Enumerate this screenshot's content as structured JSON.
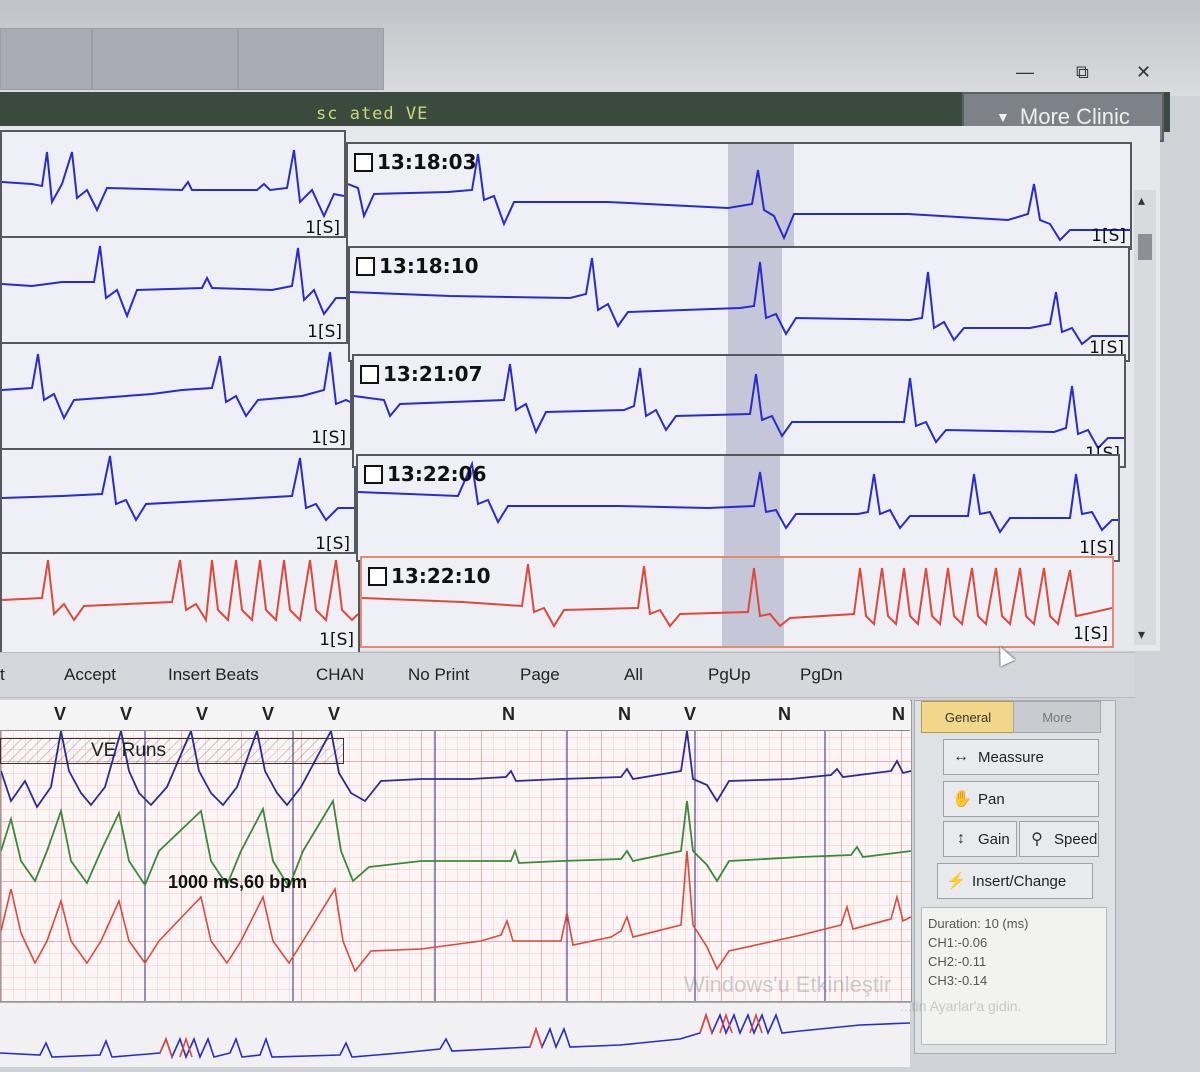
{
  "window": {
    "subtitle": "sc ated VE",
    "more_clinic_label": "More Clinic",
    "tabs": [
      "",
      "",
      ""
    ],
    "controls": {
      "minimize": "—",
      "restore": "⧉",
      "close": "✕"
    }
  },
  "strips": {
    "left_lead": [
      "1[S]",
      "1[S]",
      "1[S]",
      "1[S]",
      "1[S]"
    ],
    "right": [
      {
        "time": "13:18:03",
        "lead": "1[S]"
      },
      {
        "time": "13:18:10",
        "lead": "1[S]"
      },
      {
        "time": "13:21:07",
        "lead": "1[S]"
      },
      {
        "time": "13:22:06",
        "lead": "1[S]"
      },
      {
        "time": "13:22:10",
        "lead": "1[S]"
      }
    ]
  },
  "commands": [
    "t",
    "Accept",
    "Insert Beats",
    "CHAN",
    "No Print",
    "Page",
    "All",
    "PgUp",
    "PgDn"
  ],
  "ecg": {
    "beat_labels": [
      "V",
      "V",
      "V",
      "V",
      "V",
      "N",
      "N",
      "V",
      "N",
      "N"
    ],
    "ve_runs_label": "VE Runs",
    "measure_label": "1000 ms,60 bpm"
  },
  "side_panel": {
    "tabs": {
      "general": "General",
      "more": "More"
    },
    "tools": {
      "measure": "Meassure",
      "pan": "Pan",
      "gain": "Gain",
      "speed": "Speed",
      "insert": "Insert/Change"
    },
    "info": {
      "duration": "Duration: 10 (ms)",
      "ch1": "CH1:-0.06",
      "ch2": "CH2:-0.11",
      "ch3": "CH3:-0.14"
    }
  },
  "watermark": {
    "line1": "Windows'u Etkinleştir",
    "line2": "...tin Ayarlar'a gidin."
  },
  "colors": {
    "trace_blue": "#2a2ad4",
    "trace_red": "#e0483c",
    "trace_green": "#3a8a3a",
    "grid_red": "#e9a2a2",
    "panel_bg": "#eef0f6",
    "toolbar_dark": "#3a4a3c"
  }
}
